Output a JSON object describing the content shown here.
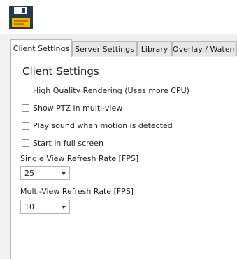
{
  "toolbar": {
    "save_icon": "floppy-disk-save-icon"
  },
  "tabs": [
    {
      "label": "Client Settings"
    },
    {
      "label": "Server Settings"
    },
    {
      "label": "Library"
    },
    {
      "label": "Overlay / Waterm"
    }
  ],
  "panel": {
    "title": "Client Settings",
    "options": [
      {
        "label": "High Quality Rendering (Uses more CPU)",
        "checked": false
      },
      {
        "label": "Show PTZ in multi-view",
        "checked": false
      },
      {
        "label": "Play sound when motion is detected",
        "checked": false
      },
      {
        "label": "Start in full screen",
        "checked": false
      }
    ],
    "single_view": {
      "label": "Single View Refresh Rate [FPS]",
      "value": "25"
    },
    "multi_view": {
      "label": "Multi-View Refresh Rate [FPS]",
      "value": "10"
    }
  }
}
